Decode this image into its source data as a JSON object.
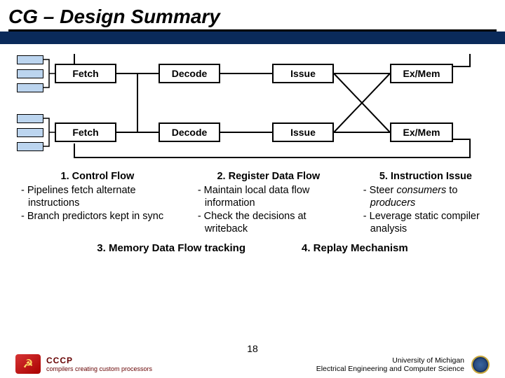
{
  "title": "CG – Design Summary",
  "stages": {
    "fetch": "Fetch",
    "decode": "Decode",
    "issue": "Issue",
    "exmem": "Ex/Mem"
  },
  "blocks": {
    "b1": {
      "title": "1.  Control Flow",
      "l1": "- Pipelines fetch alternate instructions",
      "l2": "- Branch predictors kept in sync"
    },
    "b2": {
      "title": "2. Register Data Flow",
      "l1": "- Maintain local data flow information",
      "l2": "- Check the decisions at writeback"
    },
    "b3": {
      "title": "5. Instruction Issue",
      "l1a": "- Steer ",
      "l1b": "consumers",
      "l1c": " to ",
      "l1d": "producers",
      "l2": "- Leverage static compiler analysis"
    },
    "b4": {
      "title": "3. Memory Data Flow tracking"
    },
    "b5": {
      "title": "4. Replay Mechanism"
    }
  },
  "page": "18",
  "footer_left": {
    "acronym": "CCCP",
    "sub": "compilers creating custom processors"
  },
  "footer_right": {
    "l1": "University of Michigan",
    "l2": "Electrical Engineering and Computer Science"
  }
}
